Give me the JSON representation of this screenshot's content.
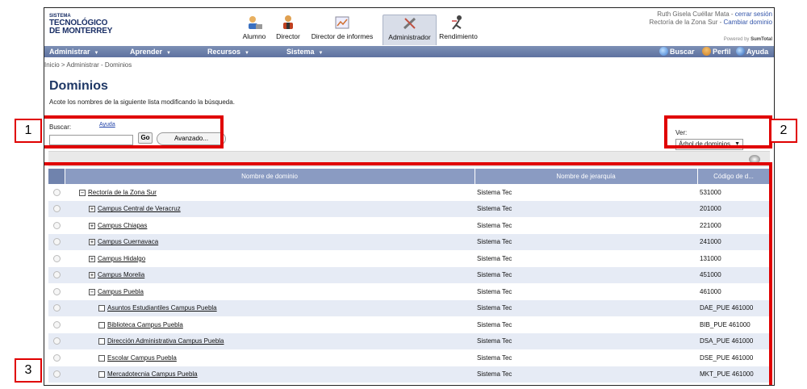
{
  "header": {
    "logo": {
      "line1": "SISTEMA",
      "line2": "TECNOLÓGICO",
      "line3": "DE MONTERREY"
    },
    "nav_icons": [
      {
        "label": "Alumno",
        "icon": "student-icon",
        "active": false
      },
      {
        "label": "Director",
        "icon": "director-icon",
        "active": false
      },
      {
        "label": "Director de informes",
        "icon": "reports-icon",
        "active": false
      },
      {
        "label": "Administrador",
        "icon": "admin-tools-icon",
        "active": true
      },
      {
        "label": "Rendimiento",
        "icon": "performance-icon",
        "active": false
      }
    ],
    "user_name": "Ruth Gisela Cuéllar Mata",
    "logout_link": "cerrar sesión",
    "org_unit": "Rectoría de la Zona Sur",
    "change_domain_link": "Cambiar dominio",
    "powered_by_prefix": "Powered by",
    "powered_by_brand": "SumTotal"
  },
  "menubar": {
    "items": [
      "Administrar",
      "Aprender",
      "Recursos",
      "Sistema"
    ],
    "right_items": [
      {
        "label": "Buscar",
        "icon": "search-icon"
      },
      {
        "label": "Perfil",
        "icon": "profile-icon"
      },
      {
        "label": "Ayuda",
        "icon": "help-icon"
      }
    ]
  },
  "breadcrumb": "Inicio > Administrar - Dominios",
  "page": {
    "title": "Dominios",
    "subtitle": "Acote los nombres de la siguiente lista modificando la búsqueda."
  },
  "search": {
    "label": "Buscar:",
    "help_link": "Ayuda",
    "value": "",
    "go_label": "Go",
    "advanced_label": "Avanzado..."
  },
  "view": {
    "label": "Ver:",
    "selected": "Árbol de dominios"
  },
  "table": {
    "columns": [
      "Nombre de dominio",
      "Nombre de jerarquía",
      "Código de d..."
    ],
    "rows": [
      {
        "name": "Rectoría de la Zona Sur",
        "level": 0,
        "toggle": "−",
        "hierarchy": "Sistema Tec",
        "code": "531000"
      },
      {
        "name": "Campus Central de Veracruz",
        "level": 1,
        "toggle": "+",
        "hierarchy": "Sistema Tec",
        "code": "201000"
      },
      {
        "name": "Campus Chiapas",
        "level": 1,
        "toggle": "+",
        "hierarchy": "Sistema Tec",
        "code": "221000"
      },
      {
        "name": "Campus Cuernavaca",
        "level": 1,
        "toggle": "+",
        "hierarchy": "Sistema Tec",
        "code": "241000"
      },
      {
        "name": "Campus Hidalgo",
        "level": 1,
        "toggle": "+",
        "hierarchy": "Sistema Tec",
        "code": "131000"
      },
      {
        "name": "Campus Morelia",
        "level": 1,
        "toggle": "+",
        "hierarchy": "Sistema Tec",
        "code": "451000"
      },
      {
        "name": "Campus Puebla",
        "level": 1,
        "toggle": "−",
        "hierarchy": "Sistema Tec",
        "code": "461000"
      },
      {
        "name": "Asuntos Estudiantiles Campus Puebla",
        "level": 2,
        "toggle": "",
        "hierarchy": "Sistema Tec",
        "code": "DAE_PUE 461000"
      },
      {
        "name": "Biblioteca Campus Puebla",
        "level": 2,
        "toggle": "",
        "hierarchy": "Sistema Tec",
        "code": "BIB_PUE 461000"
      },
      {
        "name": "Dirección Administrativa Campus Puebla",
        "level": 2,
        "toggle": "",
        "hierarchy": "Sistema Tec",
        "code": "DSA_PUE 461000"
      },
      {
        "name": "Escolar Campus Puebla",
        "level": 2,
        "toggle": "",
        "hierarchy": "Sistema Tec",
        "code": "DSE_PUE 461000"
      },
      {
        "name": "Mercadotecnia Campus Puebla",
        "level": 2,
        "toggle": "",
        "hierarchy": "Sistema Tec",
        "code": "MKT_PUE 461000"
      }
    ]
  },
  "callouts": [
    "1",
    "2",
    "3"
  ],
  "colors": {
    "callout": "#e00000",
    "menubar": "#6b7fab",
    "header_row": "#8a9bc2",
    "title": "#1f3866"
  }
}
